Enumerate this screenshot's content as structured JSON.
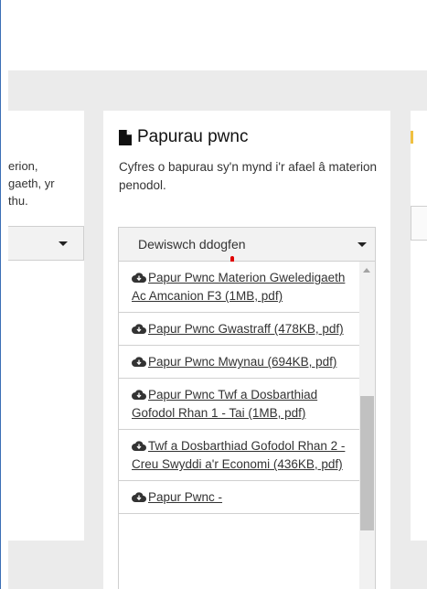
{
  "left_card": {
    "text_lines": [
      "erion,",
      "gaeth, yr",
      "thu."
    ]
  },
  "papurau_pwnc": {
    "title": "Papurau pwnc",
    "description": "Cyfres o bapurau sy'n mynd i'r afael â materion penodol.",
    "select_label": "Dewiswch ddogfen",
    "options": [
      "Papur Pwnc Materion Gweledigaeth Ac Amcanion F3 (1MB, pdf)",
      "Papur Pwnc Gwastraff (478KB, pdf)",
      "Papur Pwnc Mwynau (694KB, pdf)",
      "Papur Pwnc Twf a Dosbarthiad Gofodol Rhan 1 - Tai (1MB, pdf)",
      "Twf a Dosbarthiad Gofodol Rhan 2 - Creu Swyddi a'r Economi (436KB, pdf)",
      "Papur Pwnc -"
    ]
  },
  "icons": {
    "title_icon": "file-icon",
    "option_icon": "cloud-download-icon"
  },
  "colors": {
    "background": "#ebebeb",
    "card": "#ffffff",
    "select_bg": "#f2f2f2",
    "link": "#333333",
    "cursor": "#e00000"
  }
}
